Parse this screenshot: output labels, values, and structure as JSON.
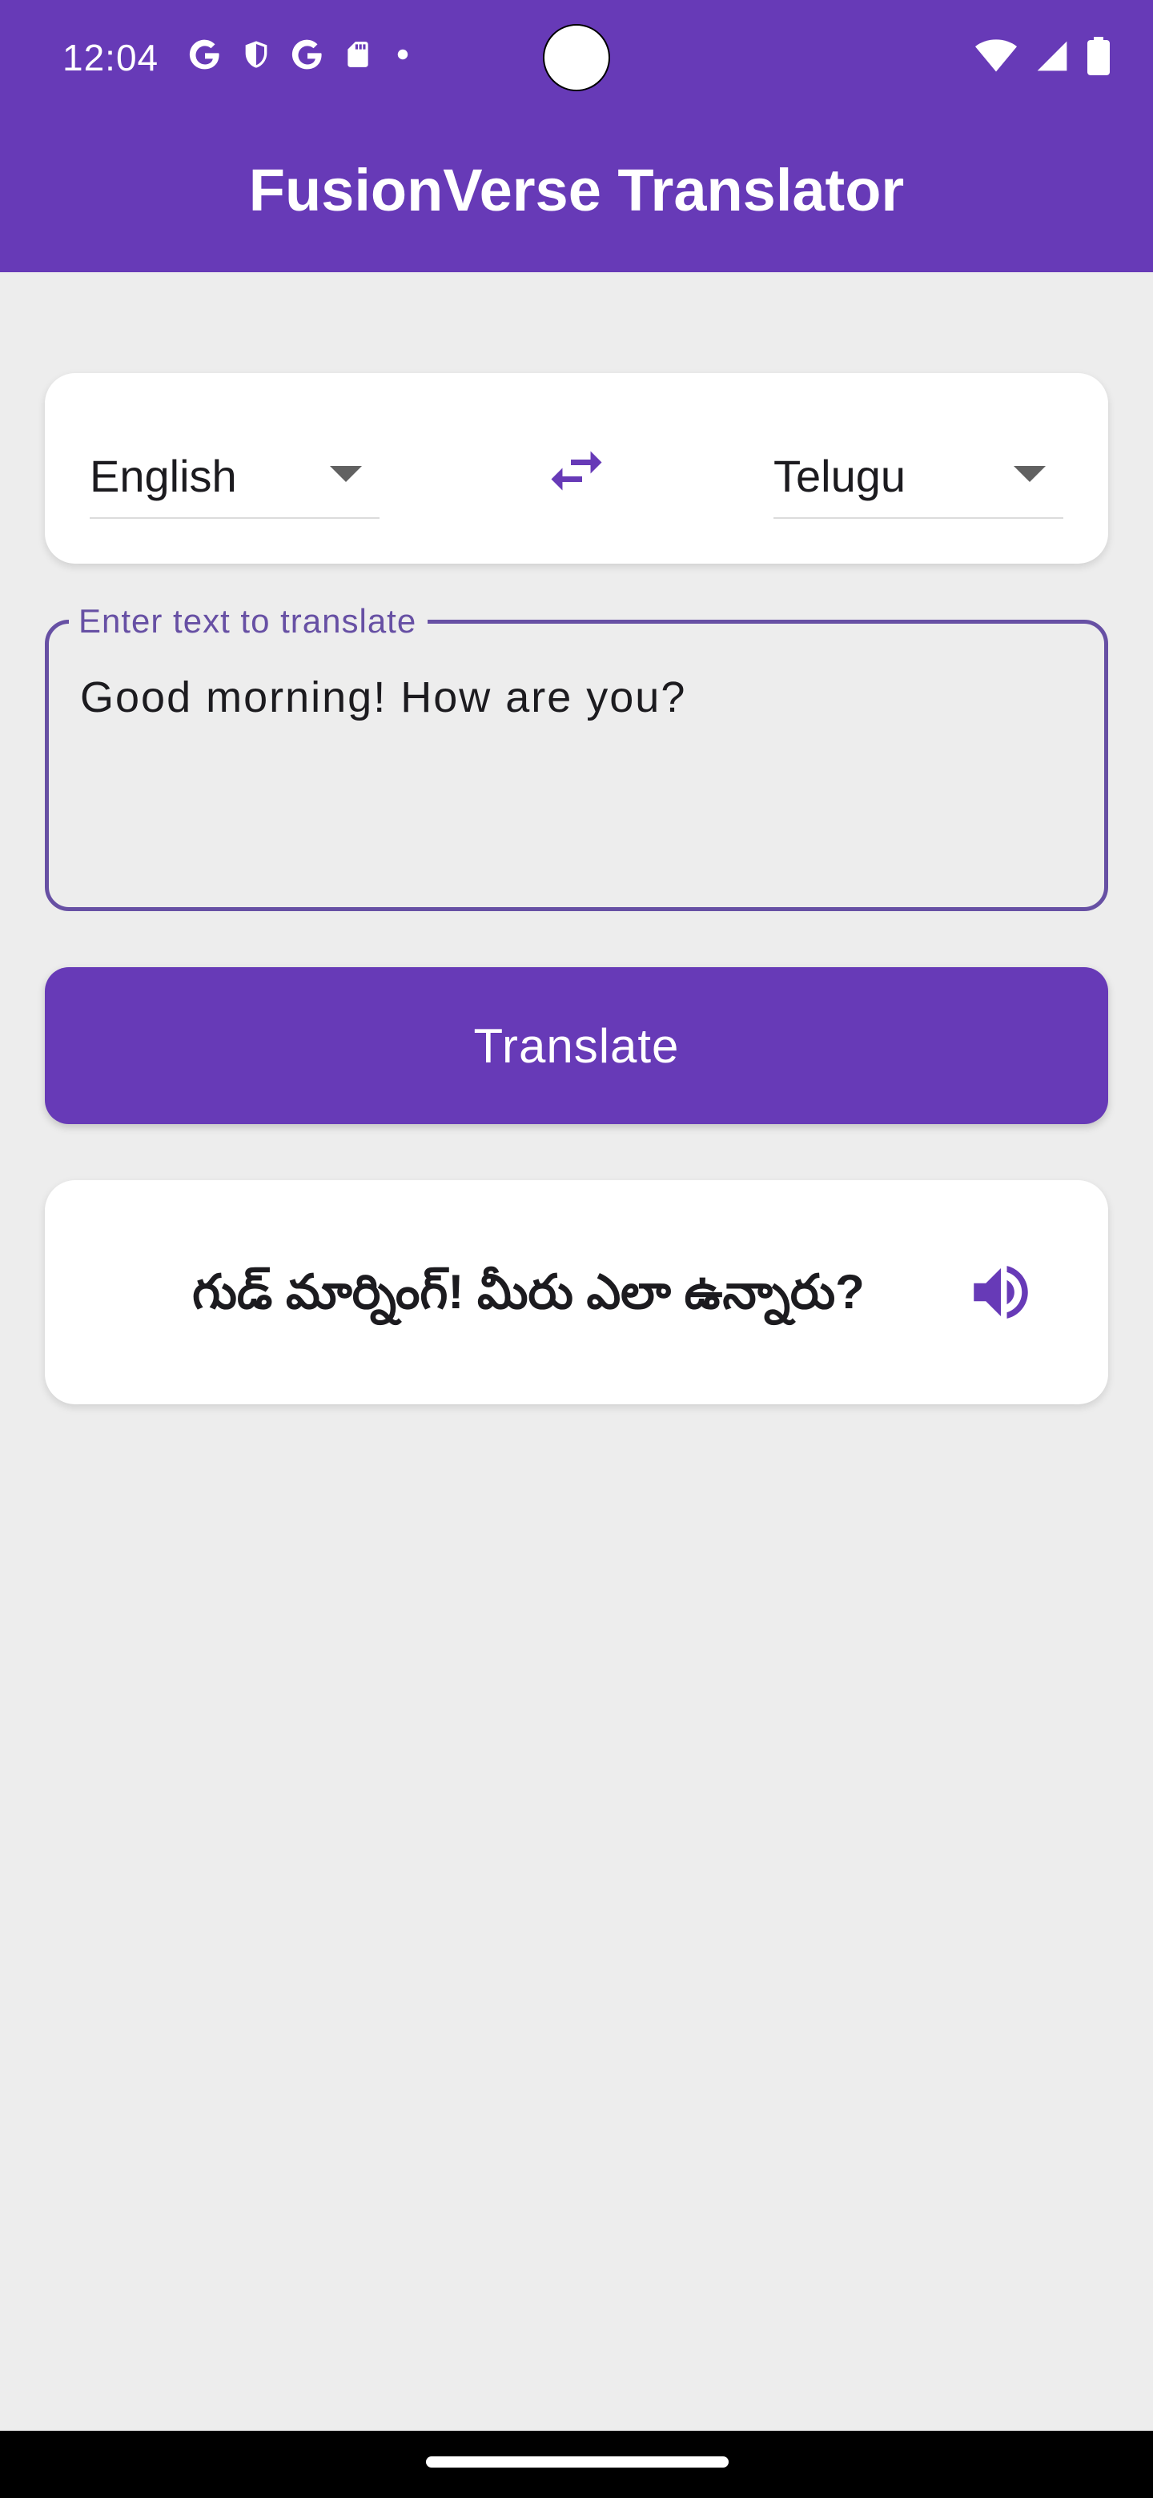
{
  "status_bar": {
    "time": "12:04",
    "left_icons": [
      "google-icon",
      "shield-icon",
      "google-icon",
      "sd-card-icon",
      "dot-icon"
    ],
    "right_icons": [
      "wifi-icon",
      "signal-icon",
      "battery-icon"
    ]
  },
  "app_bar": {
    "title": "FusionVerse Translator",
    "color": "#673ab7"
  },
  "language_selector": {
    "source_language": "English",
    "target_language": "Telugu",
    "swap_icon": "swap-horizontal-icon"
  },
  "input": {
    "label": "Enter text to translate",
    "value": "Good morning! How are you?"
  },
  "translate_button": {
    "label": "Translate"
  },
  "result": {
    "text": "గుడ్ మార్నింగ్! మీరు ఎలా ఉన్నారు?",
    "speak_icon": "volume-up-icon"
  },
  "colors": {
    "accent": "#673ab7",
    "background": "#ededed",
    "card": "#ffffff",
    "outline": "#6750a4"
  }
}
